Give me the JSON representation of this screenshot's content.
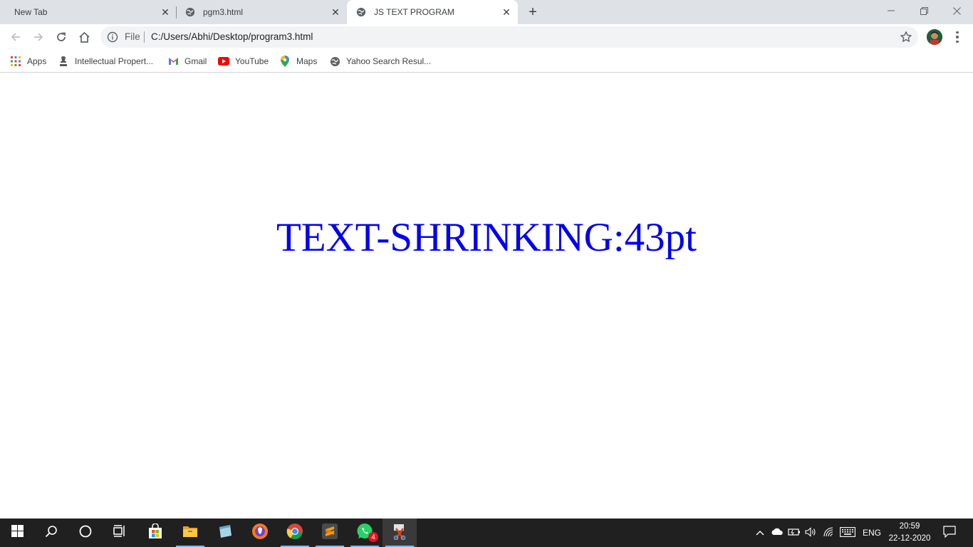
{
  "tabs": [
    {
      "label": "New Tab",
      "active": false
    },
    {
      "label": "pgm3.html",
      "active": false
    },
    {
      "label": "JS TEXT PROGRAM",
      "active": true
    }
  ],
  "toolbar": {
    "scheme_label": "File",
    "url": "C:/Users/Abhi/Desktop/program3.html"
  },
  "bookmarks": [
    {
      "label": "Apps",
      "icon": "apps-grid-icon"
    },
    {
      "label": "Intellectual Propert...",
      "icon": "emblem-icon"
    },
    {
      "label": "Gmail",
      "icon": "gmail-icon"
    },
    {
      "label": "YouTube",
      "icon": "youtube-icon"
    },
    {
      "label": "Maps",
      "icon": "maps-pin-icon"
    },
    {
      "label": "Yahoo Search Resul...",
      "icon": "globe-icon"
    }
  ],
  "page": {
    "text": "TEXT-SHRINKING:43pt",
    "text_color": "#0000ee"
  },
  "taskbar": {
    "apps": [
      {
        "name": "start-button",
        "icon": "windows-logo-icon"
      },
      {
        "name": "search-button",
        "icon": "search-icon"
      },
      {
        "name": "cortana-button",
        "icon": "circle-icon"
      },
      {
        "name": "task-view-button",
        "icon": "task-view-icon"
      },
      {
        "name": "store-app",
        "icon": "store-bag-icon"
      },
      {
        "name": "file-explorer-app",
        "icon": "folder-icon"
      },
      {
        "name": "notepad-app",
        "icon": "notepad-icon"
      },
      {
        "name": "brave-app",
        "icon": "lion-shield-icon"
      },
      {
        "name": "chrome-app",
        "icon": "chrome-icon"
      },
      {
        "name": "sublime-app",
        "icon": "sublime-icon"
      },
      {
        "name": "whatsapp-app",
        "icon": "whatsapp-icon",
        "badge": "4"
      },
      {
        "name": "snipping-tool-app",
        "icon": "snipping-icon"
      }
    ],
    "tray": {
      "language": "ENG",
      "time": "20:59",
      "date": "22-12-2020"
    }
  }
}
